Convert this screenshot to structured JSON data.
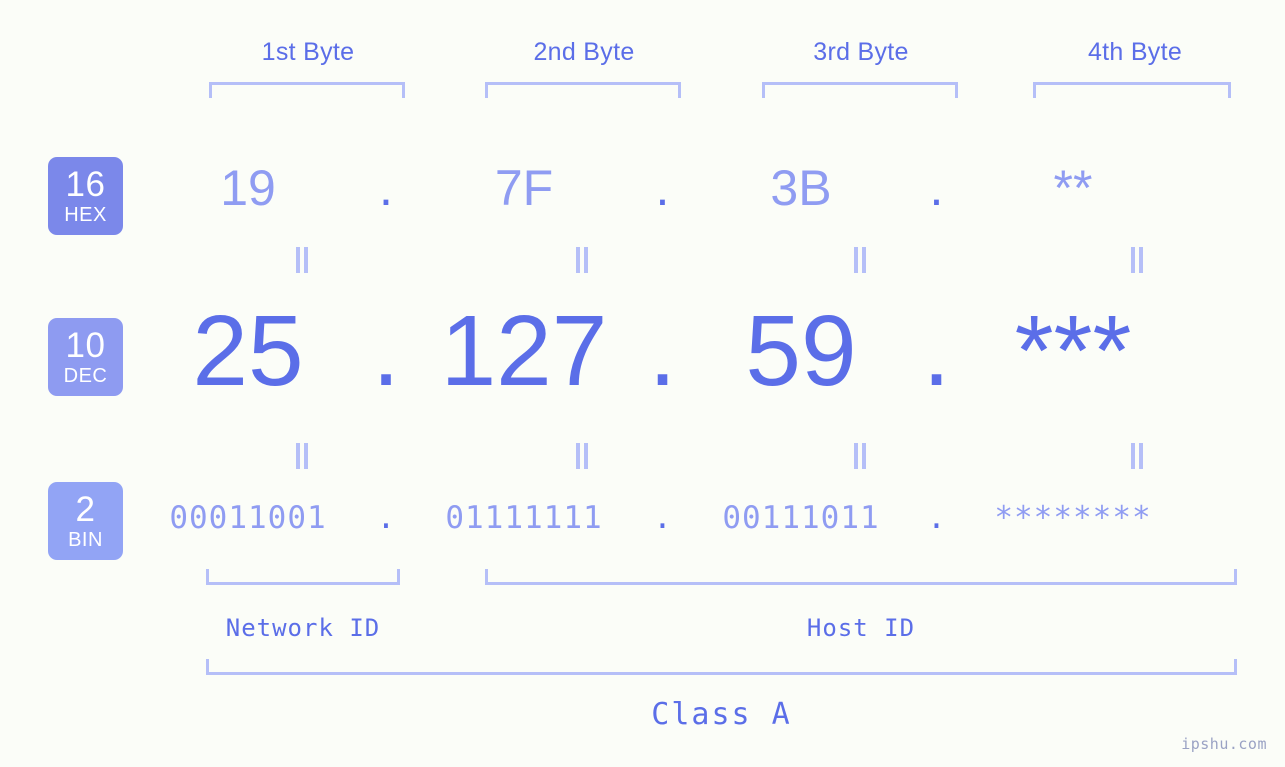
{
  "background_color": "#fbfdf8",
  "colors": {
    "accent_strong": "#5b6ee8",
    "accent_light": "#8f9cf2",
    "bracket": "#b5bff8",
    "badge_hex": "#7b88ea",
    "badge_dec": "#8e9bf1",
    "badge_bin": "#92a4f5",
    "watermark": "#9aa2c4"
  },
  "byte_headers": [
    {
      "label": "1st Byte"
    },
    {
      "label": "2nd Byte"
    },
    {
      "label": "3rd Byte"
    },
    {
      "label": "4th Byte"
    }
  ],
  "bases": [
    {
      "num": "16",
      "name": "HEX"
    },
    {
      "num": "10",
      "name": "DEC"
    },
    {
      "num": "2",
      "name": "BIN"
    }
  ],
  "rows": {
    "hex": {
      "base_num": "16",
      "base_name": "HEX",
      "values": [
        "19",
        "7F",
        "3B",
        "**"
      ],
      "separator": "."
    },
    "dec": {
      "base_num": "10",
      "base_name": "DEC",
      "values": [
        "25",
        "127",
        "59",
        "***"
      ],
      "separator": "."
    },
    "bin": {
      "base_num": "2",
      "base_name": "BIN",
      "values": [
        "00011001",
        "01111111",
        "00111011",
        "********"
      ],
      "separator": "."
    }
  },
  "equivalence_symbol": "=",
  "sections": {
    "network_id": "Network ID",
    "host_id": "Host ID",
    "class": "Class A"
  },
  "watermark": "ipshu.com"
}
